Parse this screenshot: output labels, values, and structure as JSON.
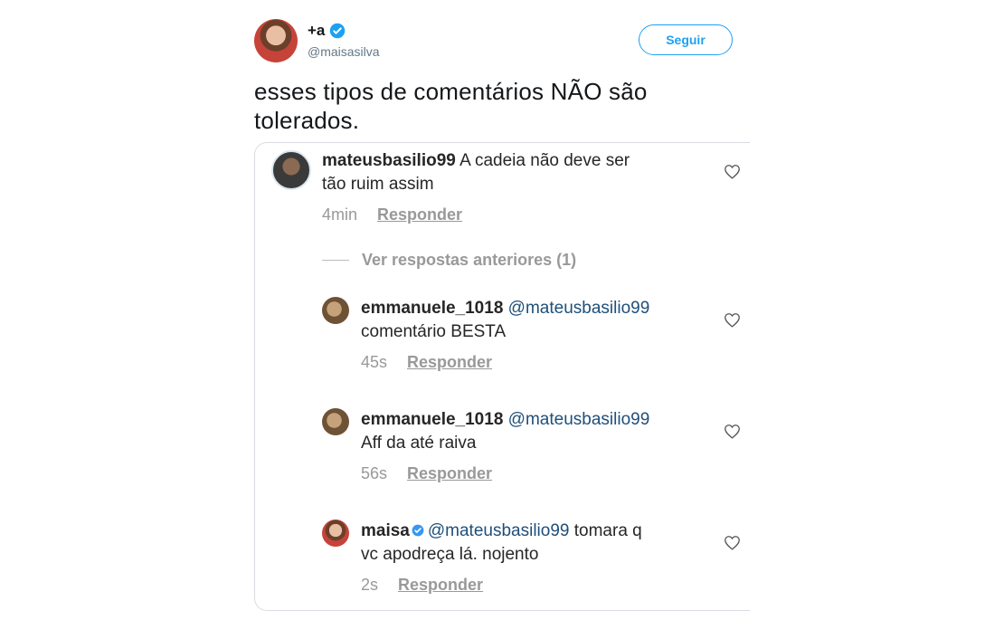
{
  "tweet": {
    "display_name": "+a",
    "handle": "@maisasilva",
    "follow_label": "Seguir",
    "text": "esses tipos de comentários NÃO são tolerados."
  },
  "screenshot": {
    "comments": [
      {
        "user": "mateusbasilio99",
        "mention": "",
        "text_line1": "A cadeia não deve ser",
        "text_line2": "tão ruim assim",
        "time": "4min",
        "reply_label": "Responder"
      }
    ],
    "view_previous": "Ver respostas anteriores (1)",
    "replies": [
      {
        "user": "emmanuele_1018",
        "mention": "@mateusbasilio99",
        "text_line1": "",
        "text_line2": "comentário BESTA",
        "time": "45s",
        "reply_label": "Responder"
      },
      {
        "user": "emmanuele_1018",
        "mention": "@mateusbasilio99",
        "text_line1": "",
        "text_line2": "Aff da até raiva",
        "time": "56s",
        "reply_label": "Responder"
      },
      {
        "user": "maisa",
        "mention": "@mateusbasilio99",
        "text_line1": "tomara q",
        "text_line2": "vc apodreça lá. nojento",
        "time": "2s",
        "reply_label": "Responder"
      }
    ]
  },
  "colors": {
    "twitter_blue": "#1da1f2",
    "mention_blue": "#1f4f7a",
    "meta_gray": "#999999"
  }
}
